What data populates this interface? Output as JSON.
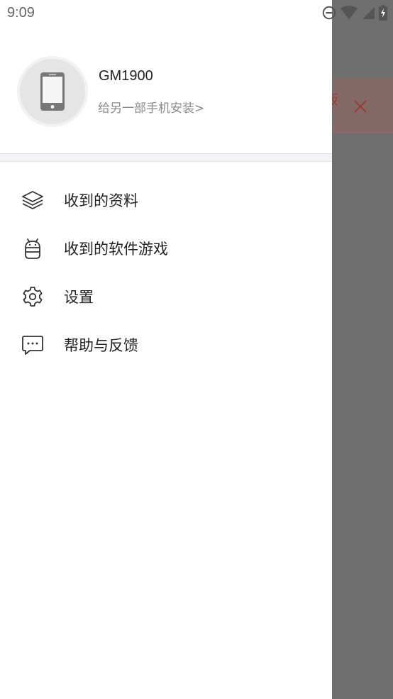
{
  "status_bar": {
    "time": "9:09",
    "icons": [
      "do-not-disturb-icon",
      "wifi-icon",
      "signal-icon",
      "battery-charging-icon"
    ]
  },
  "background": {
    "banner_text": "板",
    "close_icon": "close-icon"
  },
  "drawer": {
    "header": {
      "avatar_icon": "phone-icon",
      "device_name": "GM1900",
      "install_link": "给另一部手机安装>"
    },
    "menu": [
      {
        "icon": "layers-icon",
        "label": "收到的资料"
      },
      {
        "icon": "android-icon",
        "label": "收到的软件游戏"
      },
      {
        "icon": "gear-icon",
        "label": "设置"
      },
      {
        "icon": "chat-bubble-icon",
        "label": "帮助与反馈"
      }
    ]
  },
  "colors": {
    "scrim": "#6f6f6f",
    "drawer_bg": "#ffffff",
    "banner_bg": "#846a67",
    "banner_accent": "#9a3b35"
  }
}
